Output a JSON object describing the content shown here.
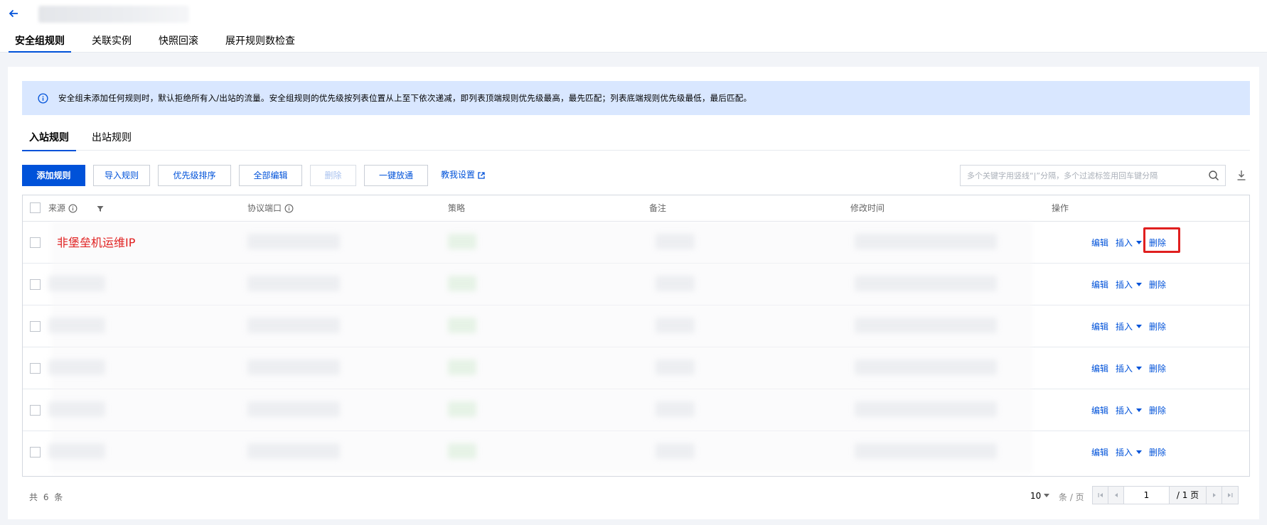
{
  "header": {
    "top_tabs": [
      {
        "label": "安全组规则",
        "active": true
      },
      {
        "label": "关联实例",
        "active": false
      },
      {
        "label": "快照回滚",
        "active": false
      },
      {
        "label": "展开规则数检查",
        "active": false
      }
    ]
  },
  "notice": {
    "text": "安全组未添加任何规则时，默认拒绝所有入/出站的流量。安全组规则的优先级按列表位置从上至下依次递减，即列表顶端规则优先级最高，最先匹配；列表底端规则优先级最低，最后匹配。"
  },
  "direction_tabs": [
    {
      "label": "入站规则",
      "active": true
    },
    {
      "label": "出站规则",
      "active": false
    }
  ],
  "toolbar": {
    "add_label": "添加规则",
    "import_label": "导入规则",
    "priority_label": "优先级排序",
    "edit_all_label": "全部编辑",
    "delete_label": "删除",
    "allow_all_label": "一键放通",
    "help_label": "教我设置",
    "search_placeholder": "多个关键字用竖线“|”分隔，多个过滤标签用回车键分隔"
  },
  "table": {
    "columns": {
      "source": "来源",
      "protocol_port": "协议端口",
      "policy": "策略",
      "remark": "备注",
      "modified_time": "修改时间",
      "actions": "操作"
    },
    "rows": [
      {
        "source_label": "非堡垒机运维IP",
        "actions": {
          "edit": "编辑",
          "insert": "插入",
          "delete": "删除"
        }
      },
      {
        "source_label": "",
        "actions": {
          "edit": "编辑",
          "insert": "插入",
          "delete": "删除"
        }
      },
      {
        "source_label": "",
        "actions": {
          "edit": "编辑",
          "insert": "插入",
          "delete": "删除"
        }
      },
      {
        "source_label": "",
        "actions": {
          "edit": "编辑",
          "insert": "插入",
          "delete": "删除"
        }
      },
      {
        "source_label": "",
        "actions": {
          "edit": "编辑",
          "insert": "插入",
          "delete": "删除"
        }
      },
      {
        "source_label": "",
        "actions": {
          "edit": "编辑",
          "insert": "插入",
          "delete": "删除"
        }
      }
    ]
  },
  "footer": {
    "total": "共 6 条",
    "page_size": "10",
    "per_page_label": "条 / 页",
    "current_page": "1",
    "total_pages": "/ 1 页"
  },
  "colors": {
    "accent": "#0052d9",
    "notice_bg": "#d9e7ff",
    "annotation_red": "#e01f1f"
  }
}
